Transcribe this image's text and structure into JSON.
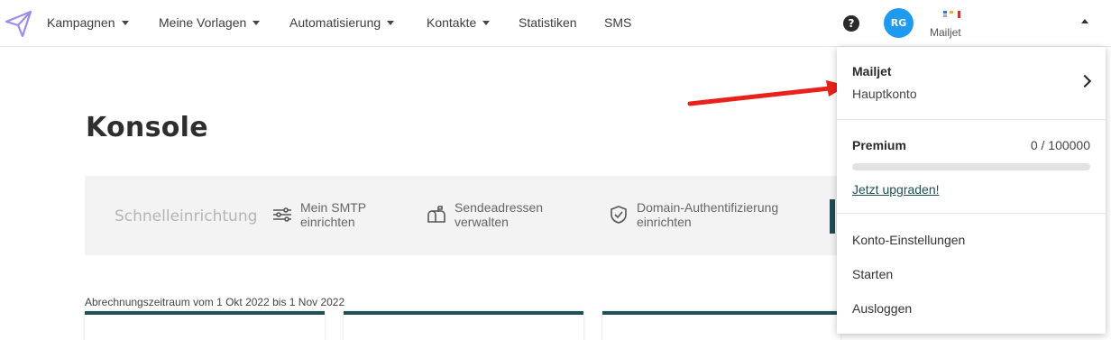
{
  "nav": {
    "items": [
      {
        "label": "Kampagnen",
        "dropdown": true
      },
      {
        "label": "Meine Vorlagen",
        "dropdown": true
      },
      {
        "label": "Automatisierung",
        "dropdown": true
      },
      {
        "label": "Kontakte",
        "dropdown": true
      },
      {
        "label": "Statistiken",
        "dropdown": false
      },
      {
        "label": "SMS",
        "dropdown": false
      }
    ],
    "help_icon": "?",
    "avatar_initials": "RG",
    "account_label": "Mailjet"
  },
  "main": {
    "title": "Konsole",
    "quick_setup": {
      "title": "Schnelleinrichtung",
      "links": [
        {
          "label": "Mein SMTP\neinrichten",
          "icon": "sliders-icon"
        },
        {
          "label": "Sendeadressen\nverwalten",
          "icon": "mailbox-icon"
        },
        {
          "label": "Domain-Authentifizierung\neinrichten",
          "icon": "shield-check-icon"
        }
      ]
    },
    "billing_period": "Abrechnungszeitraum vom 1 Okt 2022 bis 1 Nov 2022"
  },
  "dropdown": {
    "account_name": "Mailjet",
    "account_type": "Hauptkonto",
    "plan": "Premium",
    "usage": "0 / 100000",
    "usage_fraction": 0,
    "upgrade_label": "Jetzt upgraden!",
    "menu_items": [
      "Konto-Einstellungen",
      "Starten",
      "Ausloggen"
    ]
  },
  "colors": {
    "accent": "#1f4f57",
    "avatar": "#1e9bf0",
    "logo": "#9b8cf0",
    "annotation_arrow": "#e8221a"
  }
}
